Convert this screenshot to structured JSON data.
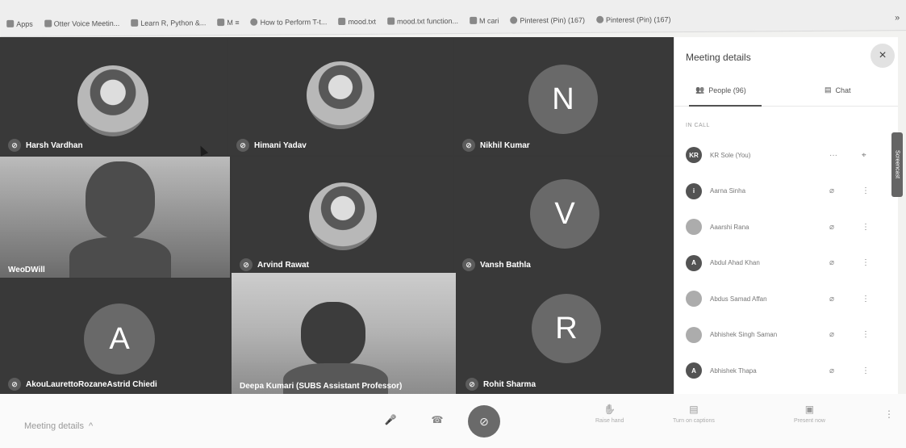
{
  "bookmarks": [
    {
      "label": "Apps",
      "icon": "apps-grid-icon"
    },
    {
      "label": "Otter Voice Meetin...",
      "icon": "otter-icon"
    },
    {
      "label": "Learn R, Python &...",
      "icon": "datacamp-icon"
    },
    {
      "label": "M ≡",
      "icon": "gmail-icon"
    },
    {
      "label": "How to Perform T-t...",
      "icon": "globe-icon"
    },
    {
      "label": "mood.txt",
      "icon": "rstudio-icon"
    },
    {
      "label": "mood.txt function...",
      "icon": "rstudio-icon"
    },
    {
      "label": "M cari",
      "icon": "gmail-icon"
    },
    {
      "label": "Pinterest (Pin) (167)",
      "icon": "pinterest-icon"
    },
    {
      "label": "Pinterest (Pin) (167)",
      "icon": "pinterest-icon"
    }
  ],
  "bookmarks_more": "»",
  "tiles": [
    {
      "name": "Harsh Vardhan",
      "type": "photo"
    },
    {
      "name": "Himani Yadav",
      "type": "photo"
    },
    {
      "name": "Nikhil Kumar",
      "type": "letter",
      "letter": "N"
    },
    {
      "name": "WeoDWill",
      "type": "video"
    },
    {
      "name": "Arvind Rawat",
      "type": "photo"
    },
    {
      "name": "Vansh Bathla",
      "type": "letter",
      "letter": "V"
    },
    {
      "name": "AkouLaurettoRozaneAstrid Chiedi",
      "type": "letter",
      "letter": "A"
    },
    {
      "name": "Deepa Kumari (SUBS Assistant Professor)",
      "type": "video"
    },
    {
      "name": "Rohit Sharma",
      "type": "letter",
      "letter": "R"
    }
  ],
  "panel": {
    "title": "Meeting details",
    "close": "×",
    "people_tab": "People (96)",
    "chat_tab": "Chat",
    "section": "IN CALL",
    "participants": [
      {
        "initials": "KR",
        "name": "KR Sole (You)",
        "action": "···",
        "right": "pin-icon"
      },
      {
        "initials": "i",
        "name": "Aarna Sinha",
        "action": "mic-off-icon",
        "right": "more-vert-icon"
      },
      {
        "initials": "",
        "name": "Aaarshi Rana",
        "action": "mic-off-icon",
        "right": "more-vert-icon"
      },
      {
        "initials": "A",
        "name": "Abdul Ahad Khan",
        "action": "mic-off-icon",
        "right": "more-vert-icon"
      },
      {
        "initials": "",
        "name": "Abdus Samad Affan",
        "action": "mic-off-icon",
        "right": "more-vert-icon"
      },
      {
        "initials": "",
        "name": "Abhishek Singh Saman",
        "action": "mic-off-icon",
        "right": "more-vert-icon"
      },
      {
        "initials": "A",
        "name": "Abhishek Thapa",
        "action": "mic-off-icon",
        "right": "more-vert-icon"
      }
    ]
  },
  "side_tab": "Screencast",
  "bottom": {
    "meeting_details": "Meeting details",
    "chevron": "^",
    "raise_hand": "Raise hand",
    "captions": "Turn on captions",
    "present": "Present now",
    "more": "⋮"
  }
}
